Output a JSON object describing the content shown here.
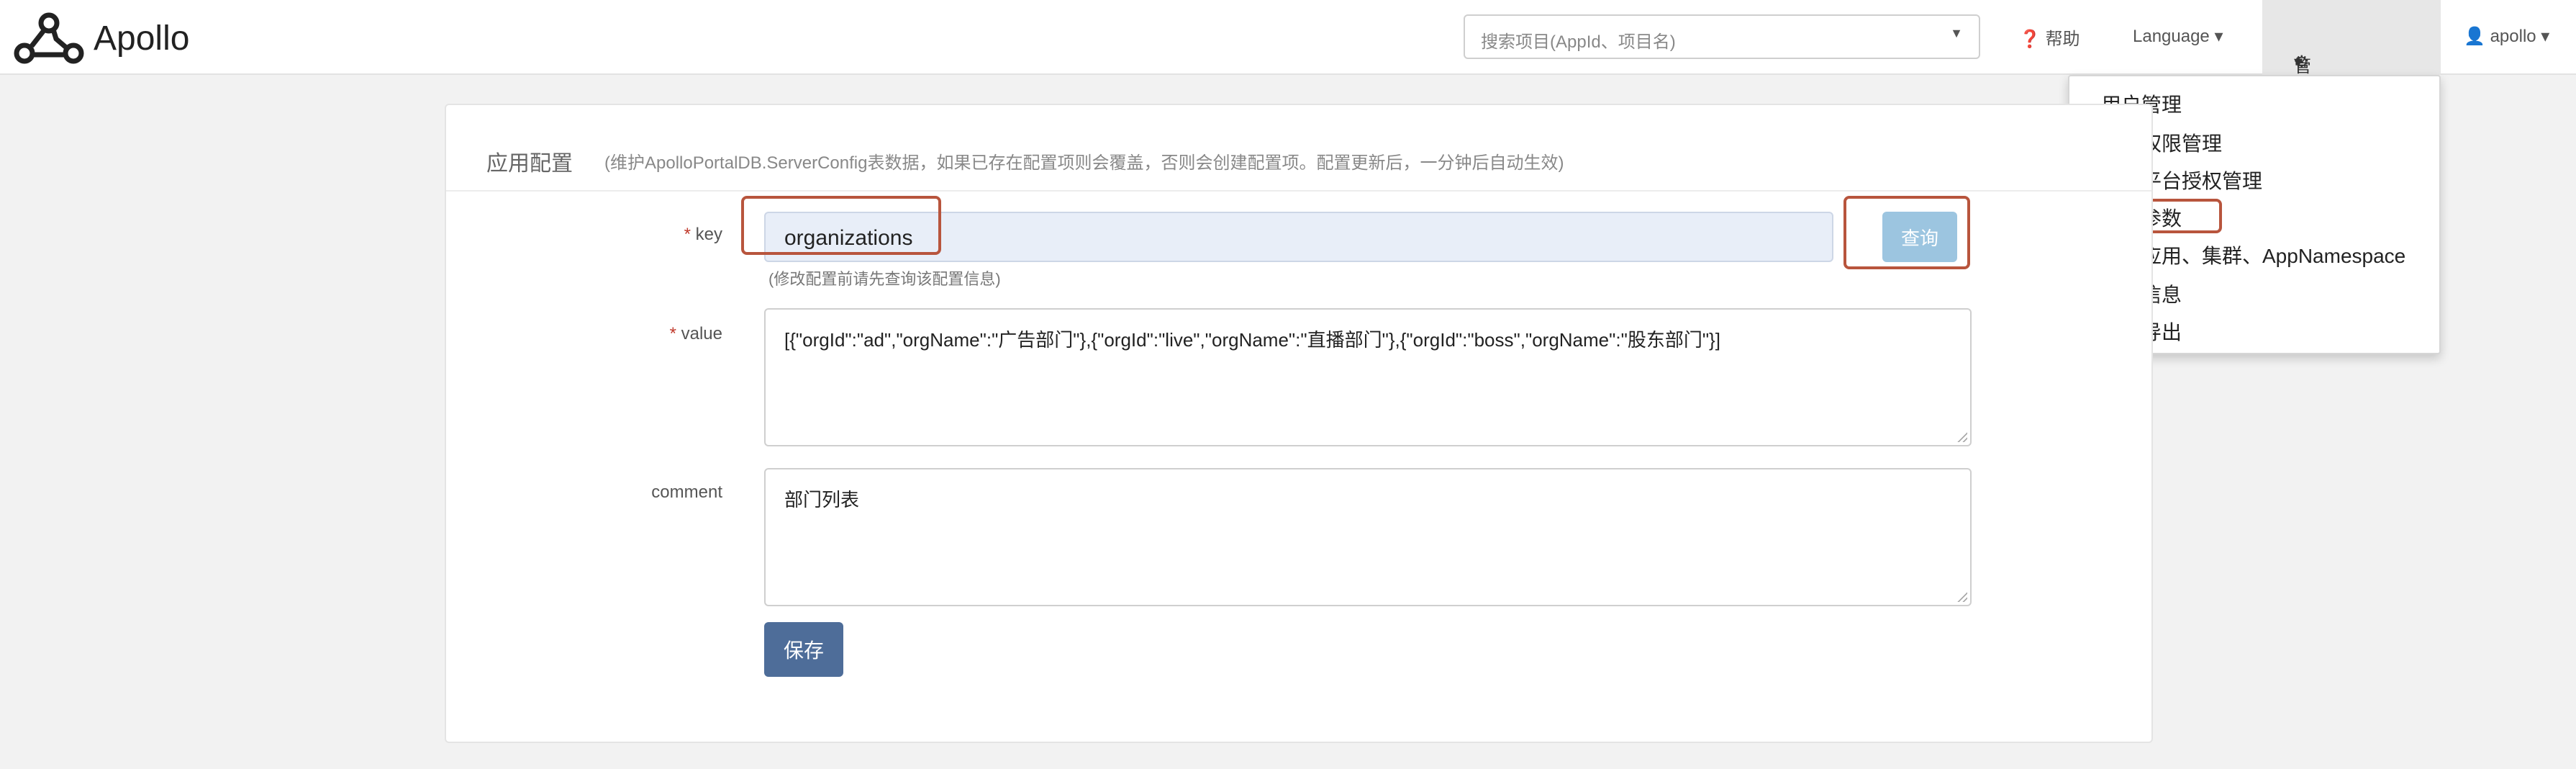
{
  "navbar": {
    "brand": "Apollo",
    "search_placeholder": "搜索项目(AppId、项目名)",
    "help_label": "帮助",
    "language_label": "Language",
    "admin_tools_label": "管理员工具",
    "user_label": "apollo"
  },
  "admin_menu": {
    "items": [
      "用户管理",
      "系统权限管理",
      "开放平台授权管理",
      "系统参数",
      "删除应用、集群、AppNamespace",
      "系统信息",
      "配置导出"
    ],
    "selected": "系统参数"
  },
  "panel": {
    "title": "应用配置",
    "description": "(维护ApolloPortalDB.ServerConfig表数据，如果已存在配置项则会覆盖，否则会创建配置项。配置更新后，一分钟后自动生效)"
  },
  "form": {
    "key_label": "key",
    "key_value": "organizations",
    "key_help": "(修改配置前请先查询该配置信息)",
    "query_label": "查询",
    "value_label": "value",
    "value_value": "[{\"orgId\":\"ad\",\"orgName\":\"广告部门\"},{\"orgId\":\"live\",\"orgName\":\"直播部门\"},{\"orgId\":\"boss\",\"orgName\":\"股东部门\"}]",
    "comment_label": "comment",
    "comment_value": "部门列表",
    "save_label": "保存",
    "required_mark": "*"
  },
  "colors": {
    "highlight": "#b8553d",
    "save_button": "#4e6d99",
    "query_button": "#9cc5e0"
  }
}
